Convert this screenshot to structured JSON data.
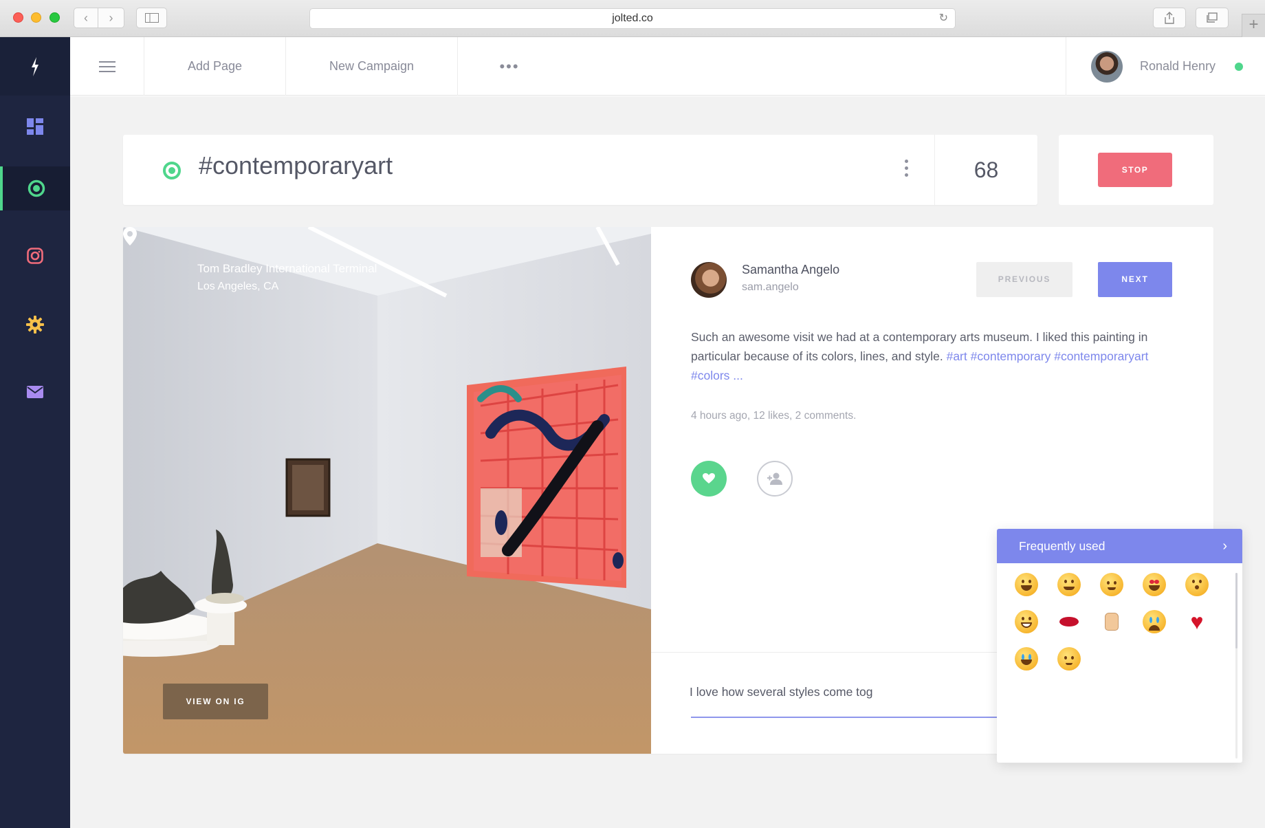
{
  "browser": {
    "url": "jolted.co",
    "icons": [
      "back-icon",
      "forward-icon",
      "sidebar-icon",
      "reload-icon",
      "share-icon",
      "tabs-icon",
      "new-tab-icon"
    ]
  },
  "app": {
    "brand_icon": "lightning-bolt-icon",
    "sidebar": {
      "items": [
        {
          "name": "dashboard",
          "icon": "dashboard-grid-icon",
          "color": "#7d87ec",
          "active": false
        },
        {
          "name": "campaigns",
          "icon": "target-icon",
          "color": "#4fd68c",
          "active": true
        },
        {
          "name": "instagram",
          "icon": "instagram-icon",
          "color": "#f06c7b",
          "active": false
        },
        {
          "name": "settings",
          "icon": "gear-icon",
          "color": "#f7c04a",
          "active": false
        },
        {
          "name": "mail",
          "icon": "mail-icon",
          "color": "#a98bf0",
          "active": false
        }
      ]
    },
    "topbar": {
      "menu_icon": "hamburger-icon",
      "add_page": "Add Page",
      "new_campaign": "New Campaign",
      "more": "•••",
      "user_name": "Ronald Henry",
      "user_status_color": "#4fd68c"
    }
  },
  "campaign": {
    "hashtag": "#contemporaryart",
    "count": "68",
    "stop_label": "STOP",
    "colors": {
      "stop": "#f06c7b",
      "active": "#4fd68c"
    }
  },
  "post": {
    "location_line1": "Tom Bradley International Terminal",
    "location_line2": "Los Angeles, CA",
    "view_on_ig": "VIEW ON IG",
    "author_name": "Samantha Angelo",
    "author_handle": "sam.angelo",
    "previous_label": "PREVIOUS",
    "next_label": "NEXT",
    "caption_text": "Such an awesome visit we had at a contemporary arts museum. I liked this painting in particular because of its colors, lines, and style.",
    "caption_tags": [
      "#art",
      "#contemporary",
      "#contemporaryart",
      "#colors ..."
    ],
    "meta": "4 hours ago, 12 likes, 2 comments.",
    "comment_value": "I love how several styles come tog",
    "accent": "#7d87ec"
  },
  "emoji_picker": {
    "title": "Frequently used",
    "chevron": "›",
    "emojis": [
      "grinning",
      "smiling",
      "relaxed",
      "heart-eyes",
      "kissing-heart",
      "grin",
      "kiss-lips",
      "thumbs-up",
      "crying",
      "red-heart",
      "joy",
      "pensive"
    ]
  }
}
